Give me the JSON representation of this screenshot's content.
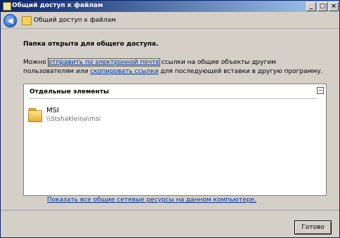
{
  "window": {
    "title": "Общий доступ к файлам",
    "buttons": {
      "minimize": "_",
      "maximize": "□",
      "close": "×"
    }
  },
  "nav": {
    "back_glyph": "◀",
    "title": "Общий доступ к файлам"
  },
  "main": {
    "heading": "Папка открыта для общего доступа.",
    "text_before": "Можно ",
    "link_email": "отправить по электронной почте",
    "text_middle": " ссылки на общие объекты другим пользователям или ",
    "link_copy": "скопировать ссылки",
    "text_after": " для последующей вставки в другую программу."
  },
  "panel": {
    "header": "Отдельные элементы",
    "collapse_glyph": "−",
    "items": [
      {
        "name": "MSI",
        "path": "\\\\Stshakleina\\msi",
        "icon": "folder-icon"
      }
    ]
  },
  "footer": {
    "show_all_link": "Показать все общие сетевые ресурсы на данном компьютере.",
    "done_button": "Готово"
  }
}
